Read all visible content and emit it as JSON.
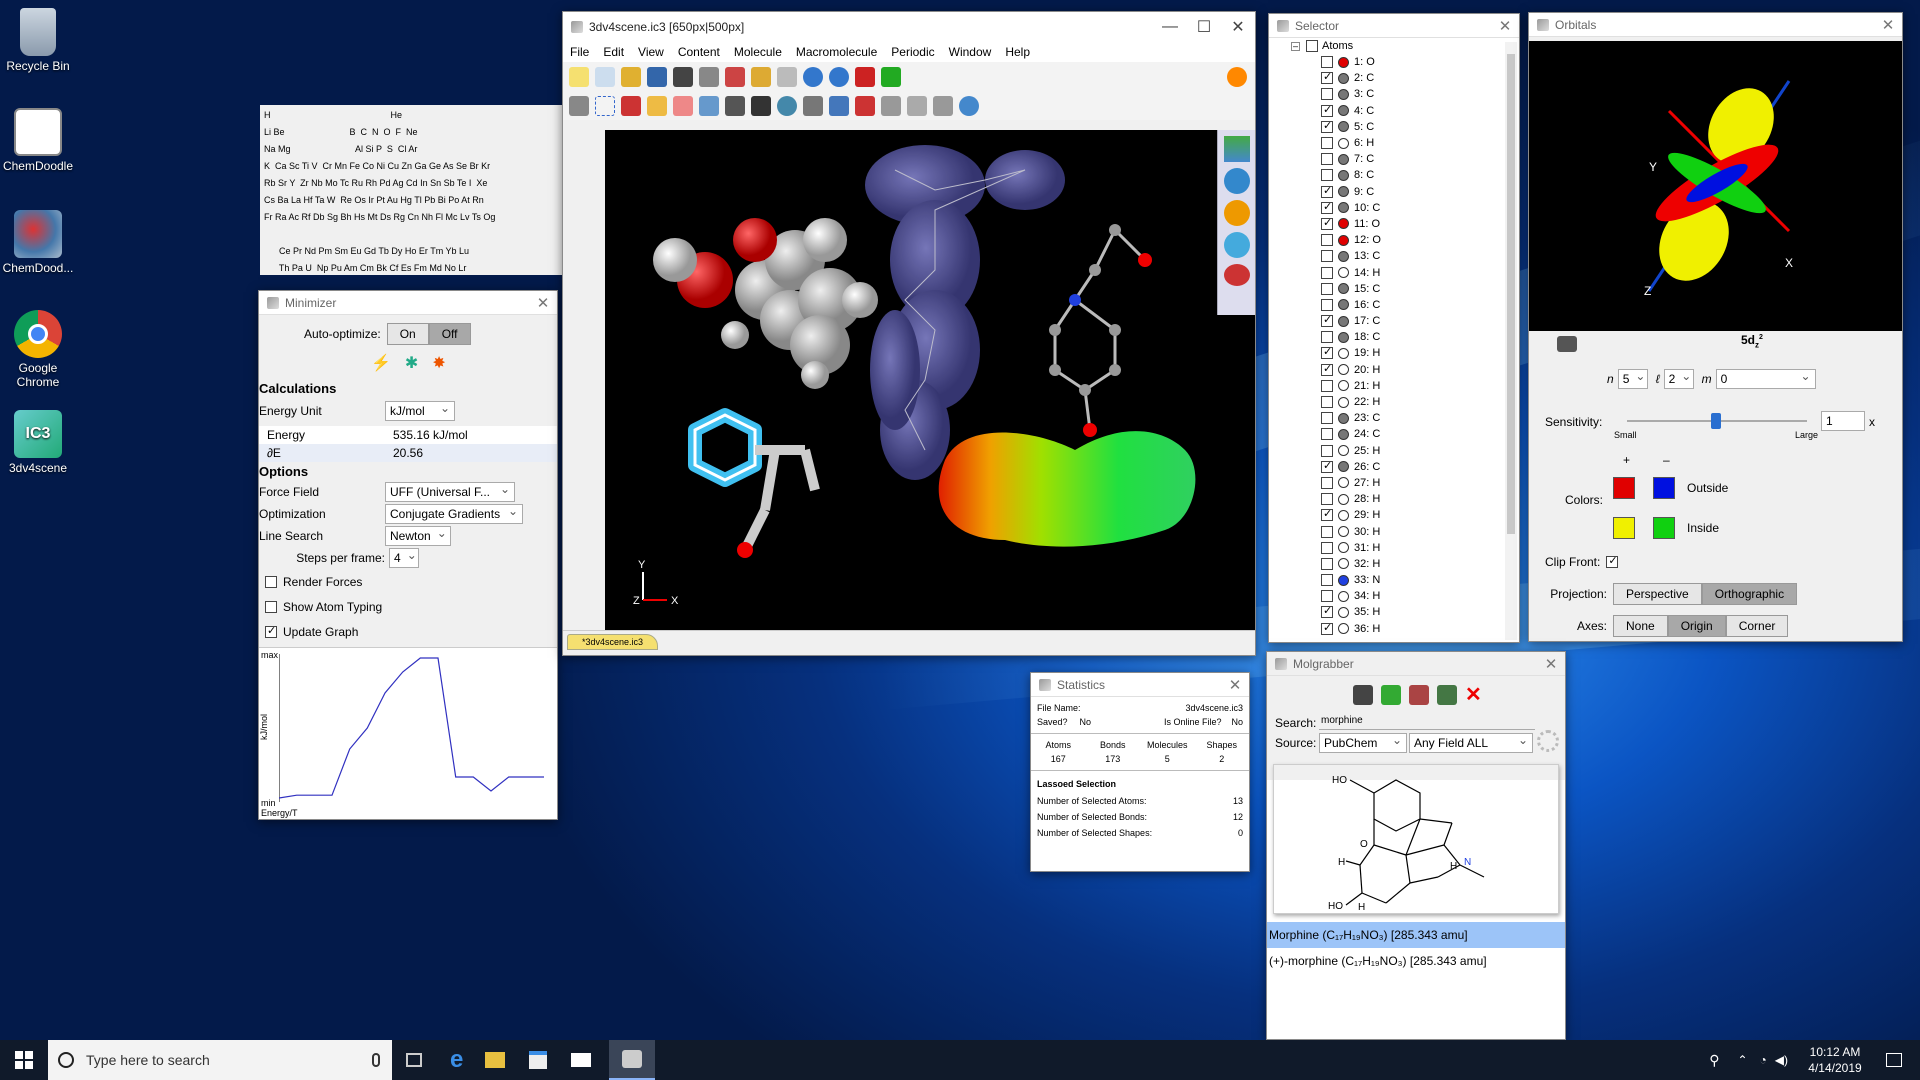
{
  "desktop": {
    "icons": [
      {
        "label": "Recycle Bin",
        "icon": "recycle-bin-icon"
      },
      {
        "label": "ChemDoodle",
        "icon": "chemdoodle-icon"
      },
      {
        "label": "ChemDood...",
        "icon": "chemdoodle-3d-icon"
      },
      {
        "label": "Google Chrome",
        "icon": "chrome-icon"
      },
      {
        "label": "3dv4scene",
        "icon": "ic3-file-icon"
      }
    ]
  },
  "periodic": {
    "rows": [
      "H                                                He",
      "Li Be                          B  C  N  O  F  Ne",
      "Na Mg                          Al Si P  S  Cl Ar",
      "K  Ca Sc Ti V  Cr Mn Fe Co Ni Cu Zn Ga Ge As Se Br Kr",
      "Rb Sr Y  Zr Nb Mo Tc Ru Rh Pd Ag Cd In Sn Sb Te I  Xe",
      "Cs Ba La Hf Ta W  Re Os Ir Pt Au Hg Tl Pb Bi Po At Rn",
      "Fr Ra Ac Rf Db Sg Bh Hs Mt Ds Rg Cn Nh Fl Mc Lv Ts Og",
      "",
      "      Ce Pr Nd Pm Sm Eu Gd Tb Dy Ho Er Tm Yb Lu",
      "      Th Pa U  Np Pu Am Cm Bk Cf Es Fm Md No Lr"
    ],
    "selected": "O"
  },
  "minimizer": {
    "title": "Minimizer",
    "auto_label": "Auto-optimize:",
    "on": "On",
    "off": "Off",
    "calc_header": "Calculations",
    "energy_unit_label": "Energy Unit",
    "energy_unit": "kJ/mol",
    "energy_label": "Energy",
    "energy_value": "535.16 kJ/mol",
    "de_label": "∂E",
    "de_value": "20.56",
    "options_header": "Options",
    "ff_label": "Force Field",
    "ff_value": "UFF (Universal F...",
    "opt_label": "Optimization",
    "opt_value": "Conjugate Gradients",
    "ls_label": "Line Search",
    "ls_value": "Newton",
    "spf_label": "Steps per frame:",
    "spf_value": "4",
    "render_forces": "Render Forces",
    "show_typing": "Show Atom Typing",
    "update_graph": "Update Graph",
    "graph_max": "max",
    "graph_min": "min",
    "graph_ylabel": "kJ/mol",
    "graph_xlabel": "Energy/T",
    "graph_values": [
      0,
      0.02,
      0.02,
      0.02,
      0.35,
      0.5,
      0.75,
      0.9,
      1,
      1,
      0.15,
      0.15,
      0.05,
      0.15,
      0.15,
      0.15
    ]
  },
  "main": {
    "title": "3dv4scene.ic3 [650px|500px]",
    "menu": [
      "File",
      "Edit",
      "View",
      "Content",
      "Molecule",
      "Macromolecule",
      "Periodic",
      "Window",
      "Help"
    ],
    "tab": "*3dv4scene.ic3",
    "axis_y": "Y",
    "axis_z": "Z",
    "axis_x": "X"
  },
  "selector": {
    "title": "Selector",
    "root": "Atoms",
    "atoms": [
      {
        "label": "1: O",
        "checked": false,
        "color": "#e00000"
      },
      {
        "label": "2: C",
        "checked": true,
        "color": "#777"
      },
      {
        "label": "3: C",
        "checked": false,
        "color": "#777"
      },
      {
        "label": "4: C",
        "checked": true,
        "color": "#777"
      },
      {
        "label": "5: C",
        "checked": true,
        "color": "#777"
      },
      {
        "label": "6: H",
        "checked": false,
        "color": "#fff"
      },
      {
        "label": "7: C",
        "checked": false,
        "color": "#777"
      },
      {
        "label": "8: C",
        "checked": false,
        "color": "#777"
      },
      {
        "label": "9: C",
        "checked": true,
        "color": "#777"
      },
      {
        "label": "10: C",
        "checked": true,
        "color": "#777"
      },
      {
        "label": "11: O",
        "checked": true,
        "color": "#e00000"
      },
      {
        "label": "12: O",
        "checked": false,
        "color": "#e00000"
      },
      {
        "label": "13: C",
        "checked": false,
        "color": "#777"
      },
      {
        "label": "14: H",
        "checked": false,
        "color": "#fff"
      },
      {
        "label": "15: C",
        "checked": false,
        "color": "#777"
      },
      {
        "label": "16: C",
        "checked": false,
        "color": "#777"
      },
      {
        "label": "17: C",
        "checked": true,
        "color": "#777"
      },
      {
        "label": "18: C",
        "checked": false,
        "color": "#777"
      },
      {
        "label": "19: H",
        "checked": true,
        "color": "#fff"
      },
      {
        "label": "20: H",
        "checked": true,
        "color": "#fff"
      },
      {
        "label": "21: H",
        "checked": false,
        "color": "#fff"
      },
      {
        "label": "22: H",
        "checked": false,
        "color": "#fff"
      },
      {
        "label": "23: C",
        "checked": false,
        "color": "#777"
      },
      {
        "label": "24: C",
        "checked": false,
        "color": "#777"
      },
      {
        "label": "25: H",
        "checked": false,
        "color": "#fff"
      },
      {
        "label": "26: C",
        "checked": true,
        "color": "#777"
      },
      {
        "label": "27: H",
        "checked": false,
        "color": "#fff"
      },
      {
        "label": "28: H",
        "checked": false,
        "color": "#fff"
      },
      {
        "label": "29: H",
        "checked": true,
        "color": "#fff"
      },
      {
        "label": "30: H",
        "checked": false,
        "color": "#fff"
      },
      {
        "label": "31: H",
        "checked": false,
        "color": "#fff"
      },
      {
        "label": "32: H",
        "checked": false,
        "color": "#fff"
      },
      {
        "label": "33: N",
        "checked": false,
        "color": "#2040e0"
      },
      {
        "label": "34: H",
        "checked": false,
        "color": "#fff"
      },
      {
        "label": "35: H",
        "checked": true,
        "color": "#fff"
      },
      {
        "label": "36: H",
        "checked": true,
        "color": "#fff"
      }
    ]
  },
  "orbitals": {
    "title": "Orbitals",
    "orbital_label": "5d",
    "orbital_sub": "z",
    "orbital_sup": "2",
    "n_label": "n",
    "n_value": "5",
    "l_label": "ℓ",
    "l_value": "2",
    "m_label": "m",
    "m_value": "0",
    "sensitivity_label": "Sensitivity:",
    "sens_small": "Small",
    "sens_large": "Large",
    "sens_value": "1",
    "sens_unit": "x",
    "plus": "+",
    "minus": "–",
    "colors_label": "Colors:",
    "outside": "Outside",
    "inside": "Inside",
    "clip_label": "Clip Front:",
    "projection_label": "Projection:",
    "perspective": "Perspective",
    "orthographic": "Orthographic",
    "axes_label": "Axes:",
    "axes_none": "None",
    "axes_origin": "Origin",
    "axes_corner": "Corner",
    "swatches": {
      "out_pos": "#e00000",
      "out_neg": "#0010e0",
      "in_pos": "#f0f000",
      "in_neg": "#10d010"
    },
    "axis_x": "X",
    "axis_y": "Y",
    "axis_z": "Z"
  },
  "statistics": {
    "title": "Statistics",
    "file_label": "File Name:",
    "file_value": "3dv4scene.ic3",
    "saved_label": "Saved?",
    "saved_value": "No",
    "online_label": "Is Online File?",
    "online_value": "No",
    "headers": [
      "Atoms",
      "Bonds",
      "Molecules",
      "Shapes"
    ],
    "values": [
      "167",
      "173",
      "5",
      "2"
    ],
    "lasso_header": "Lassoed Selection",
    "lasso": [
      {
        "label": "Number of Selected Atoms:",
        "value": "13"
      },
      {
        "label": "Number of Selected Bonds:",
        "value": "12"
      },
      {
        "label": "Number of Selected Shapes:",
        "value": "0"
      }
    ]
  },
  "molgrabber": {
    "title": "Molgrabber",
    "search_label": "Search:",
    "search_value": "morphine",
    "source_label": "Source:",
    "source_value": "PubChem",
    "field_value": "Any Field ALL",
    "results": [
      {
        "text": "Morphine (C₁₇H₁₉NO₃) [285.343 amu]"
      },
      {
        "text": "(+)-morphine (C₁₇H₁₉NO₃) [285.343 amu]"
      }
    ],
    "struct_labels": {
      "ho1": "HO",
      "ho2": "HO",
      "o": "O",
      "h1": "H",
      "h2": "H",
      "h3": "H",
      "n": "N"
    }
  },
  "taskbar": {
    "search_placeholder": "Type here to search",
    "time": "10:12 AM",
    "date": "4/14/2019"
  }
}
